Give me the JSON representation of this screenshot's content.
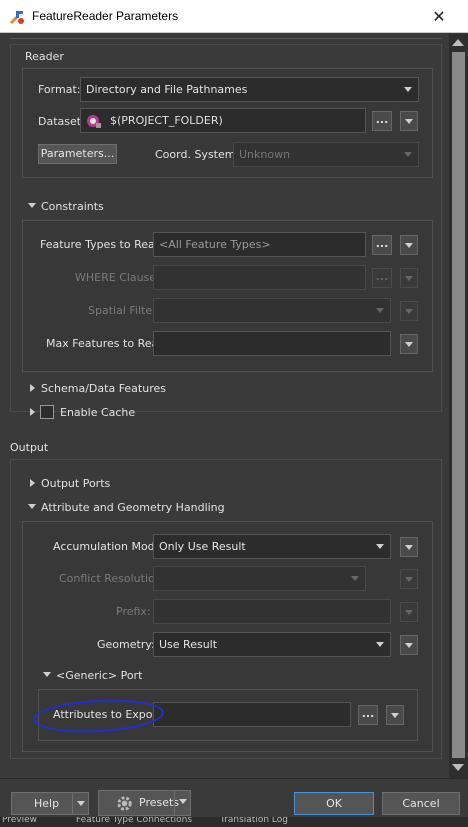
{
  "window": {
    "title": "FeatureReader Parameters",
    "close_glyph": "✕"
  },
  "reader": {
    "group_label": "Reader",
    "format_label": "Format:",
    "format_value": "Directory and File Pathnames",
    "dataset_label": "Dataset:",
    "dataset_value": "$(PROJECT_FOLDER)",
    "parameters_button": "Parameters...",
    "coord_label": "Coord. System:",
    "coord_value": "Unknown"
  },
  "constraints": {
    "title": "Constraints",
    "feature_types_label": "Feature Types to Read:",
    "feature_types_placeholder": "<All Feature Types>",
    "where_label": "WHERE Clause:",
    "spatial_label": "Spatial Filter:",
    "max_features_label": "Max Features to Read:"
  },
  "schema": {
    "title": "Schema/Data Features"
  },
  "cache": {
    "label": "Enable Cache"
  },
  "output": {
    "group_label": "Output",
    "ports_title": "Output Ports",
    "handling_title": "Attribute and Geometry Handling",
    "accumulation_label": "Accumulation Mode:",
    "accumulation_value": "Only Use Result",
    "conflict_label": "Conflict Resolution:",
    "prefix_label": "Prefix:",
    "geometry_label": "Geometry:",
    "geometry_value": "Use Result",
    "generic_port_title": "<Generic> Port",
    "attributes_label": "Attributes to Expose:"
  },
  "footer": {
    "help": "Help",
    "presets": "Presets",
    "ok": "OK",
    "cancel": "Cancel"
  },
  "bottom_tabs": [
    "Preview",
    "Feature Type Connections",
    "Translation Log"
  ],
  "colors": {
    "annotation": "#1f2fd6",
    "ok_border": "#4a90d9"
  },
  "icons": {
    "app": "transformer-icon",
    "dataset": "dataset-icon",
    "presets": "gear-icon"
  }
}
